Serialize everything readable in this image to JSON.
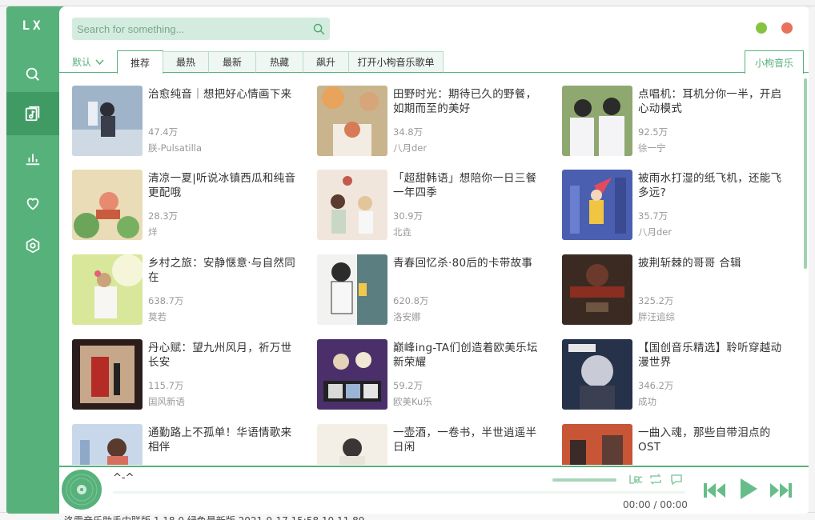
{
  "app": {
    "logo": "LX",
    "accent_color": "#57b17b"
  },
  "sidebar": {
    "items": [
      {
        "name": "search-icon",
        "active": false
      },
      {
        "name": "music-list-icon",
        "active": true
      },
      {
        "name": "chart-icon",
        "active": false
      },
      {
        "name": "heart-icon",
        "active": false
      },
      {
        "name": "settings-icon",
        "active": false
      }
    ]
  },
  "search": {
    "placeholder": "Search for something..."
  },
  "tabs": {
    "sort_label": "默认",
    "items": [
      "推荐",
      "最热",
      "最新",
      "热藏",
      "飙升",
      "打开小枸音乐歌单"
    ],
    "selected": "推荐",
    "source": "小枸音乐"
  },
  "playlists": [
    {
      "title": "治愈纯音｜想把好心情画下来",
      "count": "47.4万",
      "author": "朕-Pulsatilla"
    },
    {
      "title": "田野时光：期待已久的野餐，如期而至的美好",
      "count": "34.8万",
      "author": "八月der"
    },
    {
      "title": "点唱机：耳机分你一半，开启心动模式",
      "count": "92.5万",
      "author": "徐一宁"
    },
    {
      "title": "清凉一夏|听说冰镇西瓜和纯音更配哦",
      "count": "28.3万",
      "author": "烊"
    },
    {
      "title": "「超甜韩语」想陪你一日三餐 一年四季",
      "count": "30.9万",
      "author": "北垚"
    },
    {
      "title": "被雨水打湿的纸飞机，还能飞多远?",
      "count": "35.7万",
      "author": "八月der"
    },
    {
      "title": "乡村之旅：安静惬意·与自然同在",
      "count": "638.7万",
      "author": "莫若"
    },
    {
      "title": "青春回忆杀·80后的卡带故事",
      "count": "620.8万",
      "author": "洛安娜"
    },
    {
      "title": "披荆斩棘的哥哥 合辑",
      "count": "325.2万",
      "author": "胖汪追综"
    },
    {
      "title": "丹心赋：望九州风月，祈万世长安",
      "count": "115.7万",
      "author": "国风新语"
    },
    {
      "title": "巅峰ing-TA们创造着欧美乐坛新荣耀",
      "count": "59.2万",
      "author": "欧美Ku乐"
    },
    {
      "title": "【国创音乐精选】聆听穿越动漫世界",
      "count": "346.2万",
      "author": "成功"
    },
    {
      "title": "通勤路上不孤单！华语情歌来相伴",
      "count": "",
      "author": ""
    },
    {
      "title": "一壶酒，一卷书，半世逍遥半日闲",
      "count": "",
      "author": ""
    },
    {
      "title": "一曲入魂，那些自带泪点的OST",
      "count": "",
      "author": ""
    }
  ],
  "player": {
    "song": "^-^",
    "current_time": "00:00",
    "separator": "/",
    "total_time": "00:00",
    "lyric_icon": "lrc-icon",
    "repeat_icon": "repeat-icon",
    "comment_icon": "comment-icon"
  },
  "taskbar": {
    "text": "洛雪音乐助手内联版    1.18.0 绿色最新版    2021-9-17 15:58    10.11    89"
  }
}
